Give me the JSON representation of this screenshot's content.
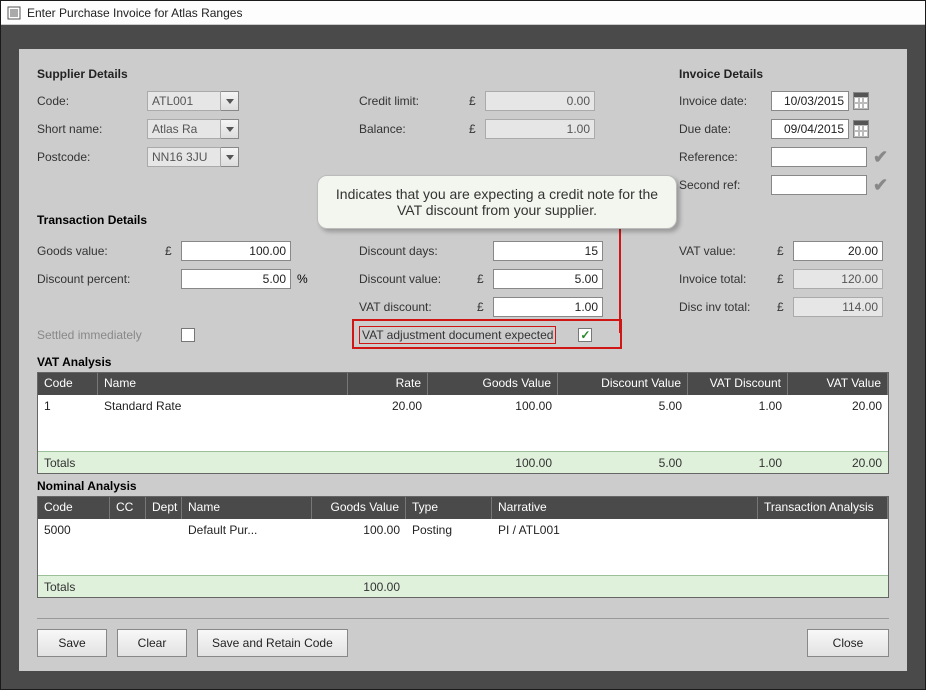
{
  "window": {
    "title": "Enter Purchase Invoice for Atlas Ranges"
  },
  "supplier": {
    "heading": "Supplier Details",
    "code_label": "Code:",
    "code_value": "ATL001",
    "short_label": "Short name:",
    "short_value": "Atlas Ra",
    "postcode_label": "Postcode:",
    "postcode_value": "NN16 3JU"
  },
  "balances": {
    "credit_limit_label": "Credit limit:",
    "credit_limit_value": "0.00",
    "balance_label": "Balance:",
    "balance_value": "1.00"
  },
  "invoice": {
    "heading": "Invoice Details",
    "date_label": "Invoice date:",
    "date_value": "10/03/2015",
    "due_label": "Due date:",
    "due_value": "09/04/2015",
    "ref_label": "Reference:",
    "ref_value": "",
    "ref2_label": "Second ref:",
    "ref2_value": ""
  },
  "transaction": {
    "heading": "Transaction Details",
    "goods_label": "Goods value:",
    "goods_value": "100.00",
    "disc_pct_label": "Discount percent:",
    "disc_pct_value": "5.00",
    "disc_days_label": "Discount days:",
    "disc_days_value": "15",
    "disc_val_label": "Discount value:",
    "disc_val_value": "5.00",
    "vat_disc_label": "VAT discount:",
    "vat_disc_value": "1.00",
    "vat_value_label": "VAT value:",
    "vat_value_value": "20.00",
    "inv_total_label": "Invoice total:",
    "inv_total_value": "120.00",
    "disc_inv_total_label": "Disc inv total:",
    "disc_inv_total_value": "114.00",
    "settled_label": "Settled immediately",
    "vat_adj_label": "VAT adjustment document expected"
  },
  "currency": "£",
  "percent": "%",
  "callout_text": "Indicates that you are expecting a credit note for the VAT discount from your supplier.",
  "vat_analysis": {
    "heading": "VAT Analysis",
    "headers": {
      "code": "Code",
      "name": "Name",
      "rate": "Rate",
      "goods": "Goods Value",
      "disc": "Discount Value",
      "vatdisc": "VAT Discount",
      "vatval": "VAT Value"
    },
    "row": {
      "code": "1",
      "name": "Standard Rate",
      "rate": "20.00",
      "goods": "100.00",
      "disc": "5.00",
      "vatdisc": "1.00",
      "vatval": "20.00"
    },
    "totals_label": "Totals",
    "totals": {
      "goods": "100.00",
      "disc": "5.00",
      "vatdisc": "1.00",
      "vatval": "20.00"
    }
  },
  "nominal_analysis": {
    "heading": "Nominal Analysis",
    "headers": {
      "code": "Code",
      "cc": "CC",
      "dept": "Dept",
      "name": "Name",
      "goods": "Goods Value",
      "type": "Type",
      "narr": "Narrative",
      "ta": "Transaction Analysis"
    },
    "row": {
      "code": "5000",
      "cc": "",
      "dept": "",
      "name": "Default Pur...",
      "goods": "100.00",
      "type": "Posting",
      "narr": "PI / ATL001",
      "ta": ""
    },
    "totals_label": "Totals",
    "totals": {
      "goods": "100.00"
    }
  },
  "buttons": {
    "save": "Save",
    "clear": "Clear",
    "save_retain": "Save and Retain Code",
    "close": "Close"
  }
}
